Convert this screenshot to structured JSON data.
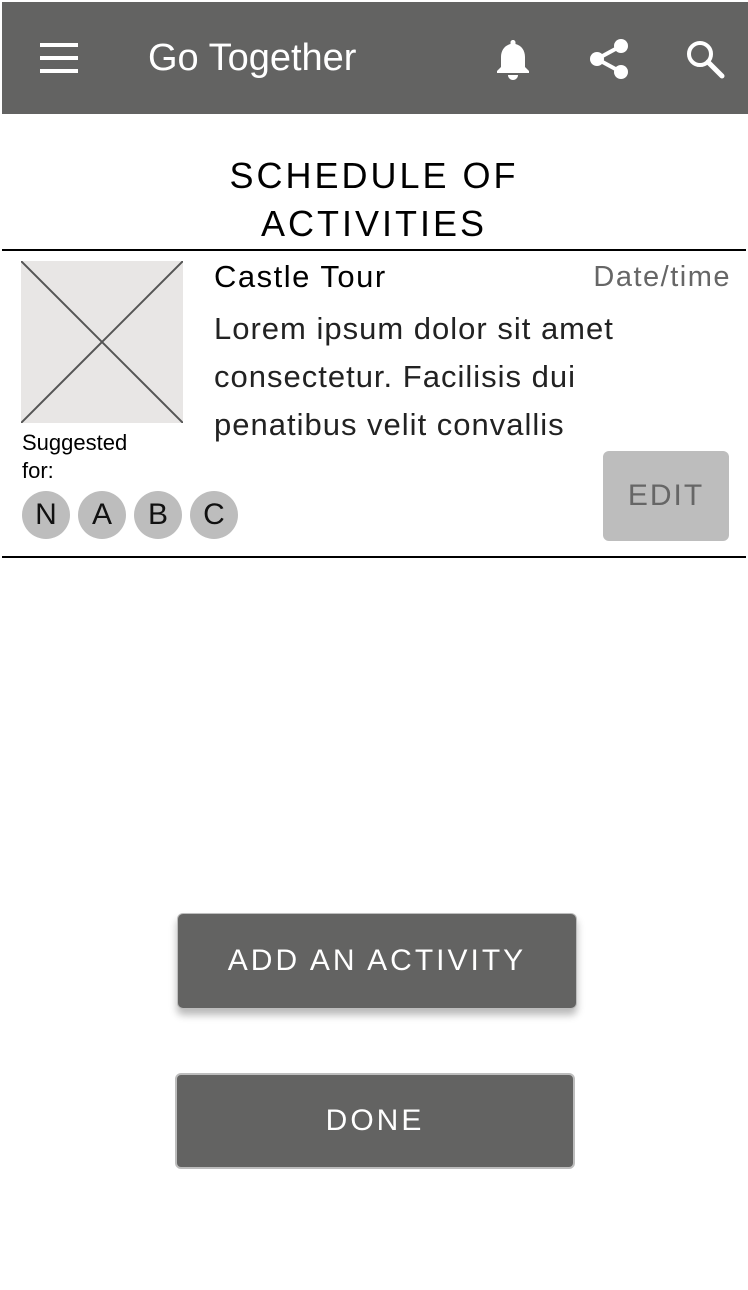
{
  "app": {
    "title": "Go Together"
  },
  "icons": {
    "menu": "menu-icon",
    "notifications": "bell-icon",
    "share": "share-icon",
    "search": "search-icon",
    "image_placeholder": "image-placeholder-icon"
  },
  "page": {
    "title": "SCHEDULE OF\nACTIVITIES"
  },
  "activity": {
    "name": "Castle Tour",
    "date_time": "Date/time",
    "description": "Lorem ipsum dolor sit amet consectetur. Facilisis dui penatibus velit convallis",
    "suggested_label": "Suggested\nfor:",
    "participants": [
      "N",
      "A",
      "B",
      "C"
    ],
    "edit_label": "EDIT"
  },
  "buttons": {
    "add_activity": "ADD AN ACTIVITY",
    "done": "DONE"
  },
  "colors": {
    "app_bar": "#636362",
    "button_primary": "#636362",
    "button_secondary": "#bdbdbd",
    "avatar": "#bdbdbd",
    "image_placeholder": "#e8e6e5"
  }
}
